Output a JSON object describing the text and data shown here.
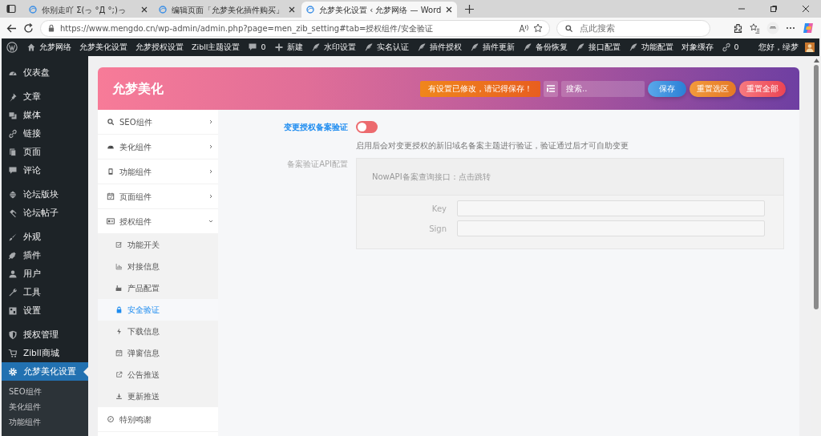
{
  "browser": {
    "tabs": [
      {
        "title": "你别走吖 Σ(っ °Д °;)っ",
        "selected": false
      },
      {
        "title": "编辑页面「允梦美化插件购买」",
        "selected": false
      },
      {
        "title": "允梦美化设置 ‹ 允梦网络 — Word",
        "selected": true
      }
    ],
    "address": "https://www.mengdo.cn/wp-admin/admin.php?page=men_zib_setting#tab=授权组件/安全验证",
    "search": {
      "placeholder": "点此搜索"
    }
  },
  "admin_bar": {
    "items": [
      {
        "kind": "home",
        "label": "允梦网络"
      },
      {
        "kind": "text",
        "label": "允梦美化设置"
      },
      {
        "kind": "text",
        "label": "允梦授权设置"
      },
      {
        "kind": "text",
        "label": "Zibll主题设置"
      },
      {
        "kind": "comments",
        "label": "0"
      },
      {
        "kind": "new",
        "label": "新建"
      },
      {
        "kind": "plugin",
        "label": "水印设置"
      },
      {
        "kind": "plugin",
        "label": "实名认证"
      },
      {
        "kind": "plugin",
        "label": "插件授权"
      },
      {
        "kind": "plugin",
        "label": "插件更新"
      },
      {
        "kind": "plugin",
        "label": "备份恢复"
      },
      {
        "kind": "plugin",
        "label": "接口配置"
      },
      {
        "kind": "plugin",
        "label": "功能配置"
      },
      {
        "kind": "text",
        "label": "对象缓存"
      },
      {
        "kind": "links",
        "label": "0"
      }
    ],
    "greeting": "您好，绿梦"
  },
  "sidebar": {
    "groups": [
      [
        {
          "label": "仪表盘",
          "selected": false
        }
      ],
      [
        {
          "label": "文章",
          "selected": false
        },
        {
          "label": "媒体",
          "selected": false
        },
        {
          "label": "链接",
          "selected": false
        },
        {
          "label": "页面",
          "selected": false
        },
        {
          "label": "评论",
          "selected": false
        }
      ],
      [
        {
          "label": "论坛版块",
          "selected": false
        },
        {
          "label": "论坛帖子",
          "selected": false
        }
      ],
      [
        {
          "label": "外观",
          "selected": false
        },
        {
          "label": "插件",
          "selected": false
        },
        {
          "label": "用户",
          "selected": false
        },
        {
          "label": "工具",
          "selected": false
        },
        {
          "label": "设置",
          "selected": false
        }
      ],
      [
        {
          "label": "授权管理",
          "selected": false
        },
        {
          "label": "Zibll商城",
          "selected": false
        },
        {
          "label": "允梦美化设置",
          "selected": true
        }
      ]
    ],
    "submenu": [
      "SEO组件",
      "美化组件",
      "功能组件"
    ]
  },
  "panel": {
    "title": "允梦美化",
    "notice": "有设置已修改，请记得保存！",
    "search": {
      "placeholder": "搜索.."
    },
    "buttons": [
      {
        "kind": "save",
        "label": "保存"
      },
      {
        "kind": "reset-section",
        "label": "重置选区"
      },
      {
        "kind": "reset-all",
        "label": "重置全部"
      }
    ],
    "nav": [
      {
        "kind": "group",
        "label": "SEO组件",
        "expanded": false
      },
      {
        "kind": "group",
        "label": "美化组件",
        "expanded": false
      },
      {
        "kind": "group",
        "label": "功能组件",
        "expanded": false
      },
      {
        "kind": "group",
        "label": "页面组件",
        "expanded": false
      },
      {
        "kind": "group",
        "label": "授权组件",
        "expanded": true,
        "children": [
          {
            "label": "功能开关",
            "selected": false
          },
          {
            "label": "对接信息",
            "selected": false
          },
          {
            "label": "产品配置",
            "selected": false
          },
          {
            "label": "安全验证",
            "selected": true
          },
          {
            "label": "下载信息",
            "selected": false
          },
          {
            "label": "弹窗信息",
            "selected": false
          },
          {
            "label": "公告推送",
            "selected": false
          },
          {
            "label": "更新推送",
            "selected": false
          }
        ]
      },
      {
        "kind": "link",
        "label": "特别鸣谢"
      }
    ],
    "fields": [
      {
        "kind": "switch",
        "label": "变更授权备案验证",
        "on": false,
        "description": "启用后会对变更授权的新旧域名备案主题进行验证，验证通过后才可自助变更"
      },
      {
        "kind": "fieldset",
        "label": "备案验证API配置",
        "subtitle": "NowAPI备案查询接口：点击跳转",
        "inputs": [
          {
            "label": "Key"
          },
          {
            "label": "Sign"
          }
        ]
      }
    ]
  }
}
